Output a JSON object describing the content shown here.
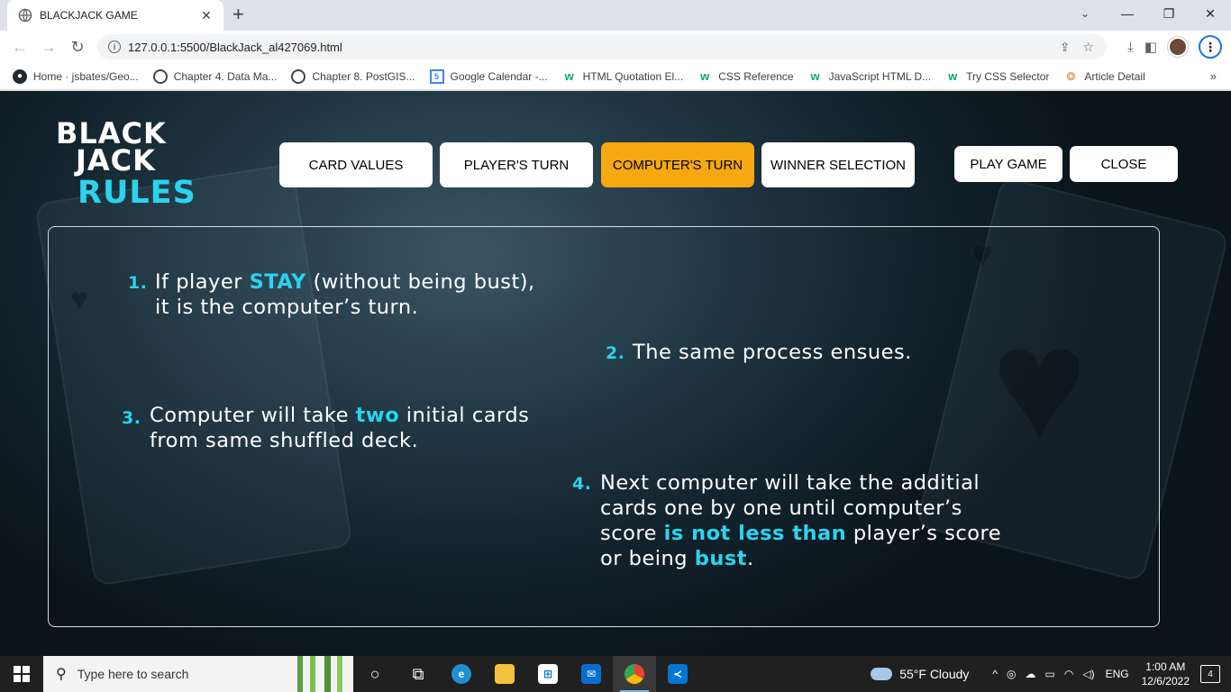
{
  "browser": {
    "tab_title": "BLACKJACK GAME",
    "url": "127.0.0.1:5500/BlackJack_al427069.html",
    "bookmarks": [
      {
        "label": "Home · jsbates/Geo...",
        "icon": "github-icon"
      },
      {
        "label": "Chapter 4. Data Ma...",
        "icon": "chapter-icon"
      },
      {
        "label": "Chapter 8. PostGIS...",
        "icon": "chapter-icon"
      },
      {
        "label": "Google Calendar -...",
        "icon": "calendar-icon"
      },
      {
        "label": "HTML Quotation El...",
        "icon": "w3-icon"
      },
      {
        "label": "CSS Reference",
        "icon": "w3-icon"
      },
      {
        "label": "JavaScript HTML D...",
        "icon": "w3-icon"
      },
      {
        "label": "Try CSS Selector",
        "icon": "w3-icon"
      },
      {
        "label": "Article Detail",
        "icon": "article-icon"
      }
    ]
  },
  "page": {
    "logo": {
      "line1": "BLACK",
      "line2": "JACK",
      "line3": "RULES"
    },
    "nav": {
      "card_values": "CARD VALUES",
      "players_turn": "PLAYER'S TURN",
      "computers_turn": "COMPUTER'S TURN",
      "winner_selection": "WINNER SELECTION",
      "active": "computers_turn"
    },
    "actions": {
      "play_game": "PLAY GAME",
      "close": "CLOSE"
    },
    "rules": [
      {
        "num": "1.",
        "parts": [
          "If player ",
          "STAY",
          " (without being bust),",
          "it is the computer’s turn."
        ]
      },
      {
        "num": "2.",
        "parts": [
          "The same process ensues."
        ]
      },
      {
        "num": "3.",
        "parts": [
          "Computer will take ",
          "two",
          " initial cards",
          "from same shuffled deck."
        ]
      },
      {
        "num": "4.",
        "parts": [
          "Next computer will take the additial",
          "cards one by one until computer’s",
          "score ",
          "is not less than",
          " player’s score",
          "or being ",
          "bust",
          "."
        ]
      }
    ],
    "colors": {
      "accent": "#2ad4ee",
      "active_tab": "#f5a80f"
    }
  },
  "taskbar": {
    "search_placeholder": "Type here to search",
    "weather": "55°F  Cloudy",
    "language": "ENG",
    "time": "1:00 AM",
    "date": "12/6/2022",
    "notifications": "4"
  }
}
